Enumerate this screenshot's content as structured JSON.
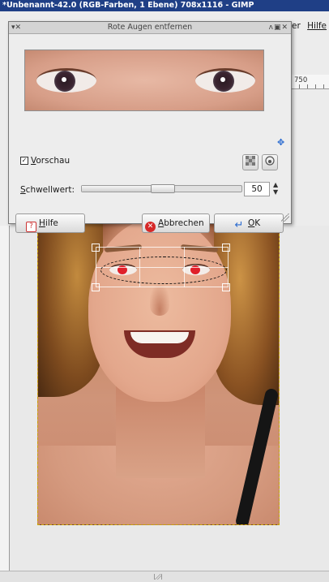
{
  "window": {
    "title": "*Unbenannt-42.0 (RGB-Farben, 1 Ebene) 708x1116 - GIMP",
    "menu": [
      {
        "label": "er",
        "underline": false
      },
      {
        "label": "Hilfe",
        "underline": true
      }
    ],
    "ruler_top_label": "750"
  },
  "dialog": {
    "title": "Rote Augen entfernen",
    "title_left_controls": "▾✕",
    "title_right_controls": "ʌ▣✕",
    "preview_checkbox": {
      "label": "Vorschau",
      "mnemonic": "V",
      "checked": true,
      "mark": "✓"
    },
    "threshold": {
      "label": "Schwellwert:",
      "value": "50",
      "fraction": 0.5
    },
    "buttons": {
      "help": "Hilfe",
      "cancel": "Abbrechen",
      "ok": "OK"
    }
  },
  "icons": {
    "move": "move-icon",
    "preview_checker": "checkerboard-icon",
    "preview_toggle": "contrast-icon",
    "help": "help-icon",
    "cancel": "cancel-icon",
    "ok": "ok-icon"
  },
  "colors": {
    "title_bar": "#1f3f86",
    "selection": "#111111",
    "red_eye": "#e0202a",
    "move_icon": "#2a6bd0"
  }
}
